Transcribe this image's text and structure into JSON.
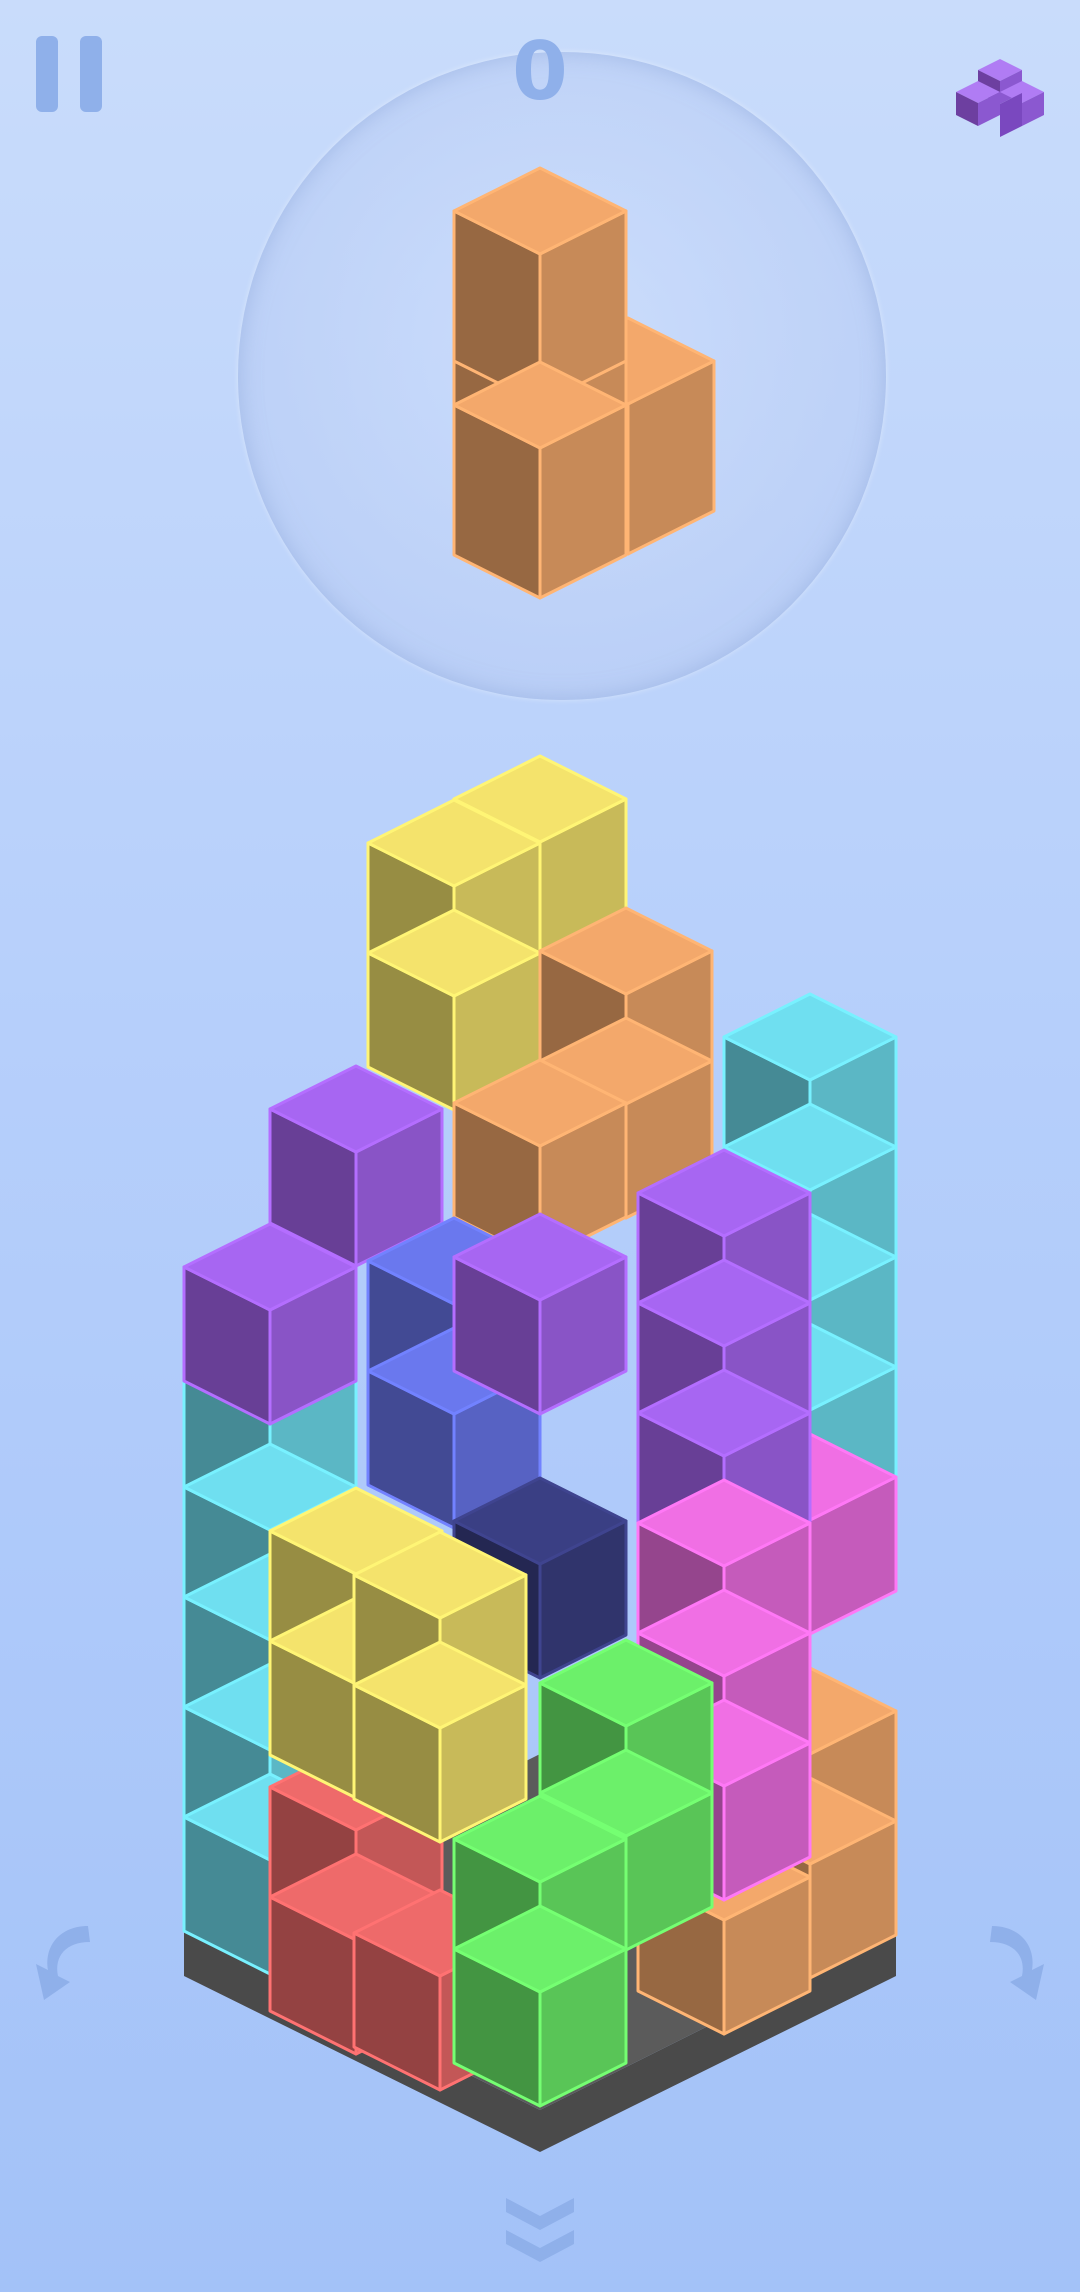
{
  "hud": {
    "score": "0",
    "pause_icon": "pause-icon",
    "next_piece_icon": "purple-piece-icon"
  },
  "controls": {
    "rotate_left_icon": "rotate-left-arrow-icon",
    "rotate_right_icon": "rotate-right-arrow-icon",
    "drop_icon": "double-chevron-down-icon"
  },
  "colors": {
    "background_top": "#c9dcfb",
    "background_bottom": "#a3c2f8",
    "ui_icon": "#8fb0ea",
    "orange": "#f3a86b",
    "yellow": "#f4e36c",
    "purple": "#a766f2",
    "blue": "#6a78ee",
    "cyan": "#6fdff0",
    "magenta": "#f06fe4",
    "green": "#6cf06a",
    "red": "#ee6a6a",
    "navy": "#3a3f84",
    "base_gray": "#555555"
  },
  "current_piece": {
    "color": "orange",
    "shape": "L"
  }
}
